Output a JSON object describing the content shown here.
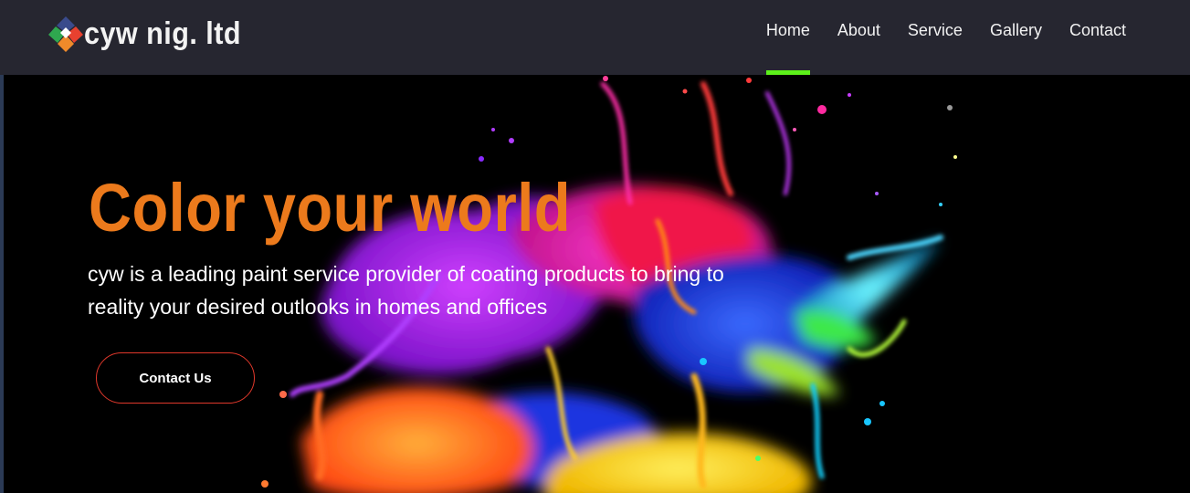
{
  "brand": {
    "name": "cyw nig. ltd",
    "logo_icon": "diamond-logo-icon"
  },
  "nav": {
    "items": [
      {
        "label": "Home",
        "active": true
      },
      {
        "label": "About",
        "active": false
      },
      {
        "label": "Service",
        "active": false
      },
      {
        "label": "Gallery",
        "active": false
      },
      {
        "label": "Contact",
        "active": false
      }
    ]
  },
  "hero": {
    "title": "Color your world",
    "text": "cyw is a leading paint service provider of coating products to bring to reality your desired outlooks in homes and offices",
    "cta_label": "Contact Us",
    "background_image": "colorful-paint-splash-image"
  },
  "colors": {
    "navbar_bg": "#262630",
    "active_underline": "#5cf01a",
    "title_orange": "#ec7a1c",
    "cta_border": "#e0382b",
    "hero_bg": "#000000"
  }
}
